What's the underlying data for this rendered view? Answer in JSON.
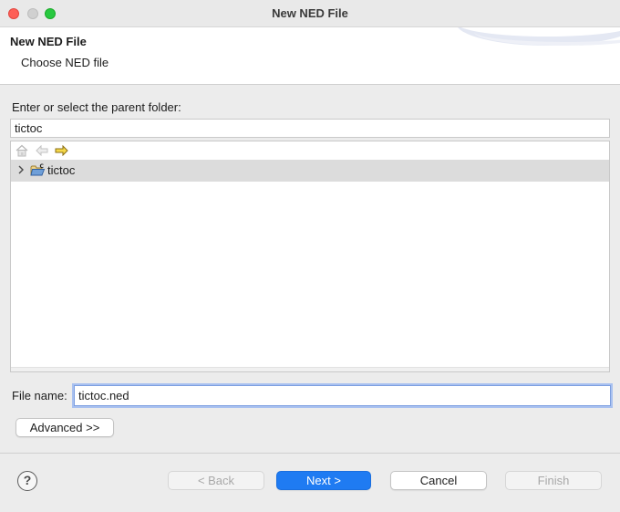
{
  "window": {
    "title": "New NED File"
  },
  "header": {
    "title": "New NED File",
    "description": "Choose NED file"
  },
  "folder": {
    "label": "Enter or select the parent folder:",
    "value": "tictoc"
  },
  "toolbar": {
    "icons": [
      "home-icon",
      "back-arrow-icon",
      "forward-arrow-icon"
    ]
  },
  "tree": {
    "items": [
      {
        "label": "tictoc",
        "icon": "project-folder-icon",
        "expanded": false,
        "selected": true
      }
    ]
  },
  "file": {
    "label": "File name:",
    "value": "tictoc.ned"
  },
  "buttons": {
    "advanced": "Advanced >>",
    "back": "< Back",
    "next": "Next >",
    "cancel": "Cancel",
    "finish": "Finish",
    "help": "?"
  },
  "colors": {
    "accent": "#1f7bf2",
    "close": "#fe5f57",
    "maximize": "#28c840",
    "selection": "#dcdcdc"
  }
}
